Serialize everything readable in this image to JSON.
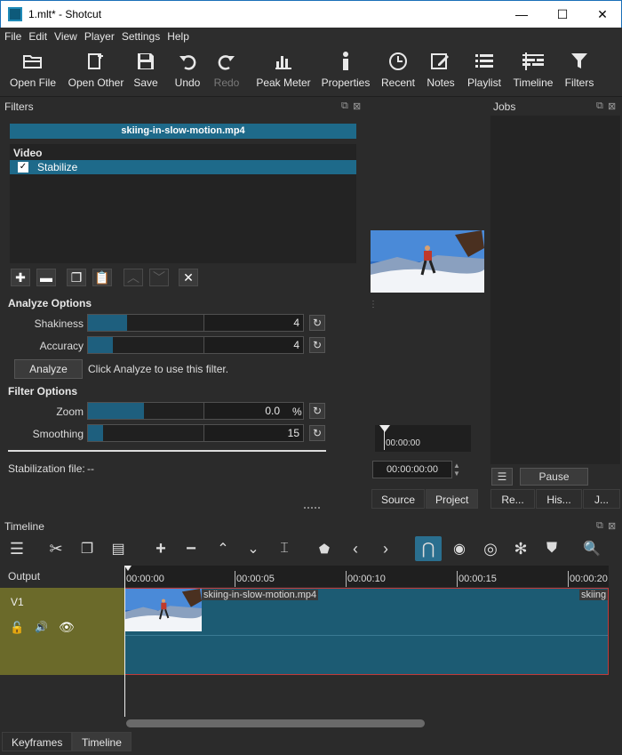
{
  "window": {
    "title": "1.mlt* - Shotcut",
    "min_glyph": "—",
    "max_glyph": "☐",
    "close_glyph": "✕"
  },
  "menu": {
    "items": [
      "File",
      "Edit",
      "View",
      "Player",
      "Settings",
      "Help"
    ]
  },
  "toolbar": {
    "open_file": "Open File",
    "open_other": "Open Other",
    "save": "Save",
    "undo": "Undo",
    "redo": "Redo",
    "peak_meter": "Peak Meter",
    "properties": "Properties",
    "recent": "Recent",
    "notes": "Notes",
    "playlist": "Playlist",
    "timeline": "Timeline",
    "filters": "Filters"
  },
  "filters_panel": {
    "title": "Filters",
    "clip_name": "skiing-in-slow-motion.mp4",
    "group_header": "Video",
    "items": [
      {
        "label": "Stabilize",
        "checked": true,
        "check_glyph": "✓"
      }
    ],
    "analyze_options_label": "Analyze Options",
    "shakiness_label": "Shakiness",
    "shakiness_value": "4",
    "shakiness_fraction": 0.14,
    "accuracy_label": "Accuracy",
    "accuracy_value": "4",
    "accuracy_fraction": 0.09,
    "analyze_button": "Analyze",
    "analyze_hint": "Click Analyze to use this filter.",
    "filter_options_label": "Filter Options",
    "zoom_label": "Zoom",
    "zoom_value": "0.0",
    "zoom_unit": "%",
    "zoom_fraction": 0.26,
    "smoothing_label": "Smoothing",
    "smoothing_value": "15",
    "smoothing_fraction": 0.07,
    "stabilization_file_label": "Stabilization file:",
    "stabilization_file_value": "--"
  },
  "player": {
    "scrub_time": "00:00:00",
    "timecode": "00:00:00:00",
    "tab_source": "Source",
    "tab_project": "Project"
  },
  "jobs_panel": {
    "title": "Jobs",
    "pause_button": "Pause",
    "tabs": [
      "Re...",
      "His...",
      "J..."
    ]
  },
  "timeline_panel": {
    "title": "Timeline",
    "output_label": "Output",
    "track_name": "V1",
    "ruler": [
      "00:00:00",
      "00:00:05",
      "00:00:10",
      "00:00:15",
      "00:00:20"
    ],
    "clip_label": "skiing-in-slow-motion.mp4",
    "clip_label_2": "skiing",
    "bottom_tabs": [
      "Keyframes",
      "Timeline"
    ]
  },
  "colors": {
    "accent": "#1e6a8a",
    "track": "#6b6a2a",
    "clip": "#1c5b73"
  }
}
